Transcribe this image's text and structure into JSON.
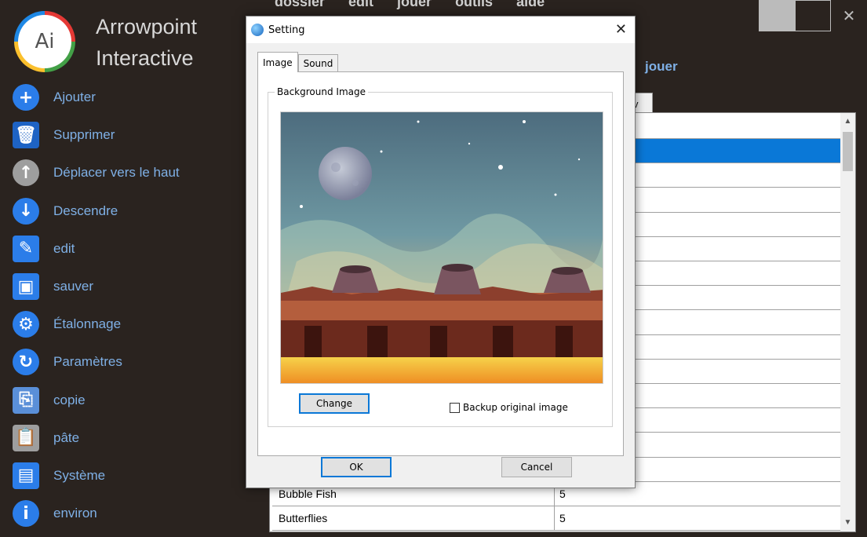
{
  "app": {
    "logo_text": "Ai",
    "brand_line1": "Arrowpoint",
    "brand_line2": "Interactive",
    "menu": [
      "dossier",
      "edit",
      "jouer",
      "outils",
      "aide"
    ],
    "jouer_label": "jouer",
    "tab_stub": "v"
  },
  "sidebar": {
    "items": [
      {
        "label": "Ajouter",
        "icon": "add-icon",
        "glyph": "+",
        "color": "#2b7de9"
      },
      {
        "label": "Supprimer",
        "icon": "trash-icon",
        "glyph": "🗑",
        "color": "#1e63c4"
      },
      {
        "label": "Déplacer vers le haut",
        "icon": "arrow-up-icon",
        "glyph": "↑",
        "color": "#9e9e9e"
      },
      {
        "label": "Descendre",
        "icon": "arrow-down-icon",
        "glyph": "↓",
        "color": "#2b7de9"
      },
      {
        "label": "edit",
        "icon": "edit-icon",
        "glyph": "✎",
        "color": "#2b7de9"
      },
      {
        "label": "sauver",
        "icon": "save-icon",
        "glyph": "▣",
        "color": "#2b7de9"
      },
      {
        "label": "Étalonnage",
        "icon": "calibration-gear-icon",
        "glyph": "⚙",
        "color": "#2b7de9"
      },
      {
        "label": "Paramètres",
        "icon": "settings-refresh-icon",
        "glyph": "↻",
        "color": "#2b7de9"
      },
      {
        "label": "copie",
        "icon": "copy-icon",
        "glyph": "⎘",
        "color": "#5a8fd8"
      },
      {
        "label": "pâte",
        "icon": "paste-icon",
        "glyph": "📋",
        "color": "#9e9e9e"
      },
      {
        "label": "Système",
        "icon": "system-icon",
        "glyph": "▤",
        "color": "#2b7de9"
      },
      {
        "label": "environ",
        "icon": "info-icon",
        "glyph": "i",
        "color": "#2b7de9"
      }
    ]
  },
  "table": {
    "rows": [
      {
        "name": "Bubble Fish",
        "value": "5"
      },
      {
        "name": "Butterflies",
        "value": "5"
      }
    ]
  },
  "dialog": {
    "title": "Setting",
    "close_glyph": "✕",
    "tabs": [
      "Image",
      "Sound"
    ],
    "group_label": "Background Image",
    "change_button": "Change",
    "backup_checkbox": "Backup original image",
    "backup_checked": false,
    "ok_button": "OK",
    "cancel_button": "Cancel"
  }
}
